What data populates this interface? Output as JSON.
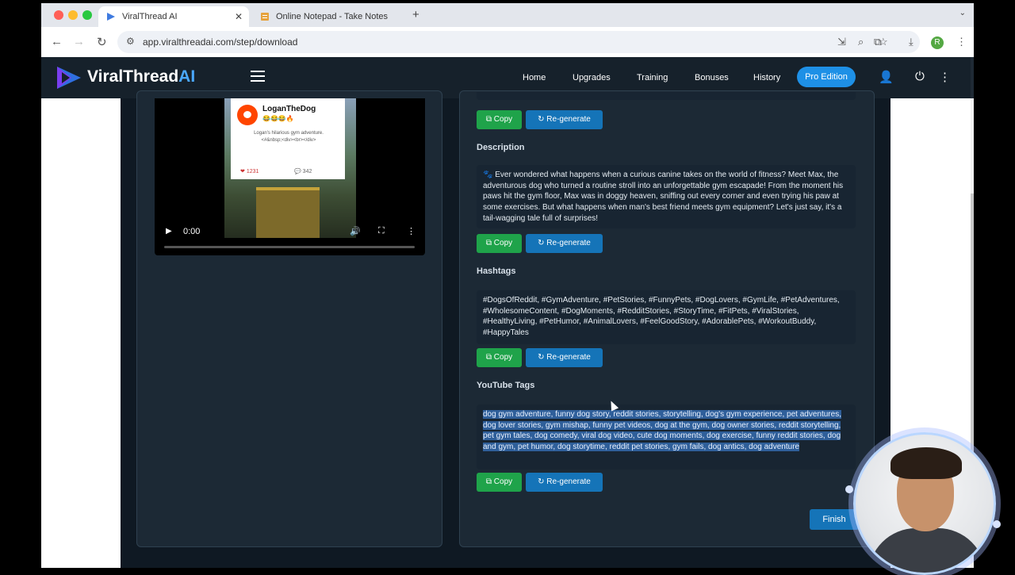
{
  "browser": {
    "tabs": [
      {
        "title": "ViralThread AI",
        "active": true
      },
      {
        "title": "Online Notepad - Take Notes",
        "active": false
      }
    ],
    "url": "app.viralthreadai.com/step/download",
    "profile_initial": "R"
  },
  "nav": {
    "logo_main": "ViralThread",
    "logo_ai": "AI",
    "links": [
      "Home",
      "Upgrades",
      "Training",
      "Bonuses",
      "History"
    ],
    "pro_label": "Pro Edition"
  },
  "video": {
    "username": "LoganTheDog",
    "emojis": "😂😂😂🔥",
    "caption": "Logan's hilarious gym adventure.",
    "caption2": "<#&nbsp;<div><br></div>",
    "likes": "1231",
    "comments": "342",
    "time": "0:00"
  },
  "sections": {
    "description": {
      "title": "Description",
      "text": "🐾 Ever wondered what happens when a curious canine takes on the world of fitness? Meet Max, the adventurous dog who turned a routine stroll into an unforgettable gym escapade! From the moment his paws hit the gym floor, Max was in doggy heaven, sniffing out every corner and even trying his paw at some exercises. But what happens when man's best friend meets gym equipment? Let's just say, it's a tail-wagging tale full of surprises!"
    },
    "hashtags": {
      "title": "Hashtags",
      "text": "#DogsOfReddit, #GymAdventure, #PetStories, #FunnyPets, #DogLovers, #GymLife, #PetAdventures, #WholesomeContent, #DogMoments, #RedditStories, #StoryTime, #FitPets, #ViralStories, #HealthyLiving, #PetHumor, #AnimalLovers, #FeelGoodStory, #AdorablePets, #WorkoutBuddy, #HappyTales"
    },
    "youtube_tags": {
      "title": "YouTube Tags",
      "text": "dog gym adventure, funny dog story, reddit stories, storytelling, dog's gym experience, pet adventures, dog lover stories, gym mishap, funny pet videos, dog at the gym, dog owner stories, reddit storytelling, pet gym tales, dog comedy, viral dog video, cute dog moments, dog exercise, funny reddit stories, dog and gym, pet humor, dog storytime, reddit pet stories, gym fails, dog antics, dog adventure"
    }
  },
  "buttons": {
    "copy": "Copy",
    "regenerate": "Re-generate",
    "finish": "Finish"
  },
  "colors": {
    "nav_bg": "#16212b",
    "content_bg": "#0f1923",
    "copy_green": "#1fa34a",
    "regen_blue": "#1574b8",
    "pro_blue": "#1e90e6"
  }
}
